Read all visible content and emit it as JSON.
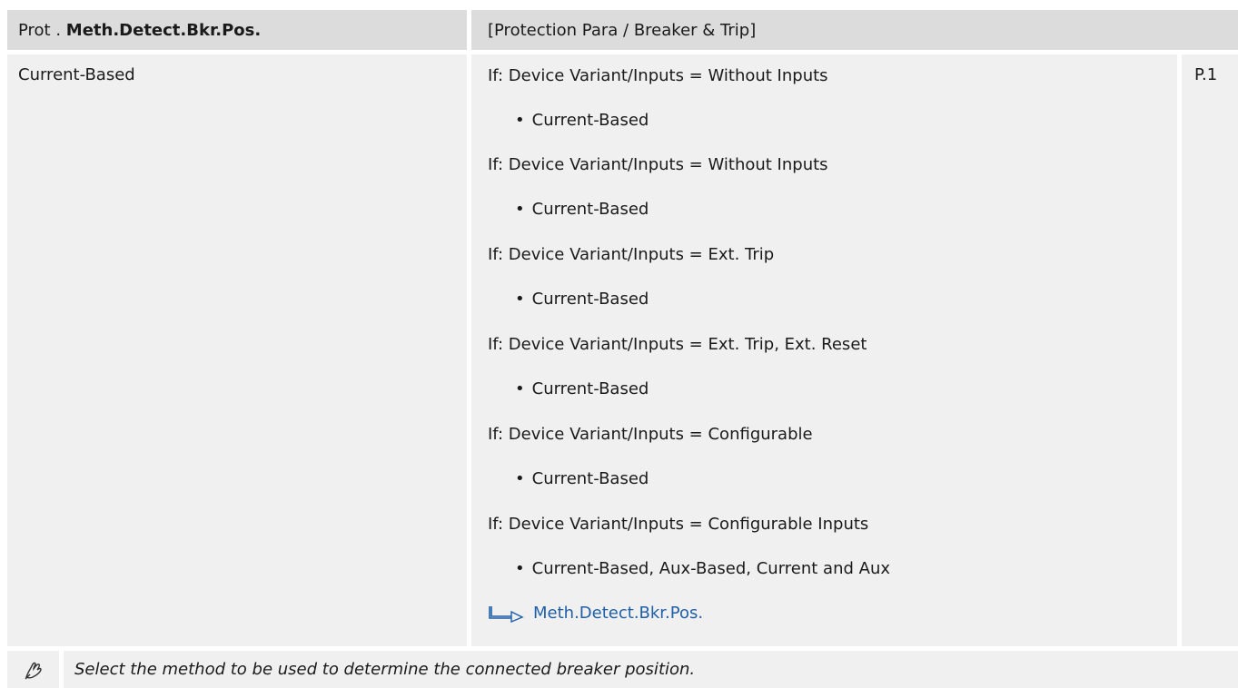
{
  "header": {
    "prefix": "Prot .",
    "param_name": "Meth.Detect.Bkr.Pos.",
    "path": "[Protection Para / Breaker & Trip]"
  },
  "default_value": "Current-Based",
  "conditions": [
    {
      "label": "If: Device Variant/Inputs = Without Inputs",
      "options": "Current-Based"
    },
    {
      "label": "If: Device Variant/Inputs = Without Inputs",
      "options": "Current-Based"
    },
    {
      "label": "If: Device Variant/Inputs = Ext. Trip",
      "options": "Current-Based"
    },
    {
      "label": "If: Device Variant/Inputs = Ext. Trip, Ext. Reset",
      "options": "Current-Based"
    },
    {
      "label": "If: Device Variant/Inputs = Configurable",
      "options": "Current-Based"
    },
    {
      "label": "If: Device Variant/Inputs = Configurable Inputs",
      "options": "Current-Based, Aux-Based, Current and Aux"
    }
  ],
  "bullet": "•",
  "link_text": "Meth.Detect.Bkr.Pos.",
  "ref": "P.1",
  "description": "Select the method to be used to determine the connected breaker position.",
  "icons": {
    "link": "link-arrow-icon",
    "footer": "setting-hand-icon"
  },
  "colors": {
    "header_bg": "#dcdcdc",
    "cell_bg": "#f0f0f0",
    "link": "#1f5fa8"
  }
}
